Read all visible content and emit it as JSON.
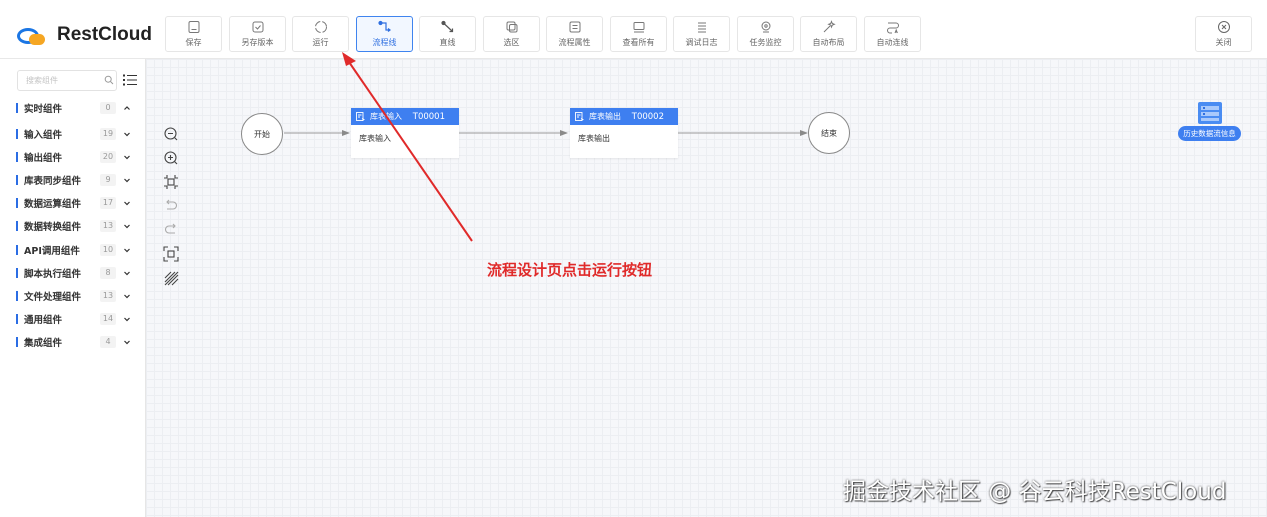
{
  "app": {
    "name": "RestCloud"
  },
  "toolbar": {
    "items": [
      {
        "label": "保存",
        "icon": "save-icon"
      },
      {
        "label": "另存版本",
        "icon": "save-as-icon"
      },
      {
        "label": "运行",
        "icon": "run-icon"
      },
      {
        "label": "流程线",
        "icon": "flow-line-icon",
        "active": true
      },
      {
        "label": "直线",
        "icon": "straight-line-icon"
      },
      {
        "label": "选区",
        "icon": "select-area-icon"
      },
      {
        "label": "流程属性",
        "icon": "flow-properties-icon"
      },
      {
        "label": "查看所有",
        "icon": "view-all-icon"
      },
      {
        "label": "调试日志",
        "icon": "debug-log-icon"
      },
      {
        "label": "任务监控",
        "icon": "task-monitor-icon"
      },
      {
        "label": "自动布局",
        "icon": "auto-layout-icon"
      },
      {
        "label": "自动连线",
        "icon": "auto-connect-icon"
      }
    ],
    "close_label": "关闭"
  },
  "sidebar": {
    "search_placeholder": "搜索组件",
    "categories": [
      {
        "name": "实时组件",
        "count": "0",
        "expanded": true
      },
      {
        "name": "输入组件",
        "count": "19"
      },
      {
        "name": "输出组件",
        "count": "20"
      },
      {
        "name": "库表同步组件",
        "count": "9"
      },
      {
        "name": "数据运算组件",
        "count": "17"
      },
      {
        "name": "数据转换组件",
        "count": "13"
      },
      {
        "name": "API调用组件",
        "count": "10"
      },
      {
        "name": "脚本执行组件",
        "count": "8"
      },
      {
        "name": "文件处理组件",
        "count": "13"
      },
      {
        "name": "通用组件",
        "count": "14"
      },
      {
        "name": "集成组件",
        "count": "4"
      }
    ]
  },
  "flow": {
    "start_label": "开始",
    "end_label": "结束",
    "nodes": [
      {
        "title": "库表输入",
        "id": "T00001",
        "body": "库表输入"
      },
      {
        "title": "库表输出",
        "id": "T00002",
        "body": "库表输出"
      }
    ]
  },
  "history_label": "历史数据流信息",
  "annotation": "流程设计页点击运行按钮",
  "watermark": "掘金技术社区 @ 谷云科技RestCloud",
  "colors": {
    "accent": "#3e7ff0",
    "annotation": "#e02a2a",
    "logo_blue": "#1b76e4",
    "logo_orange": "#f5a623"
  }
}
